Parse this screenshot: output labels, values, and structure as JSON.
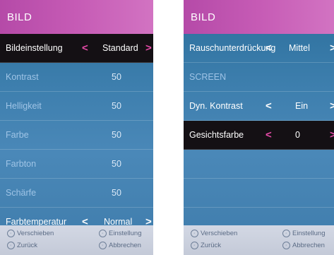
{
  "left": {
    "title": "BILD",
    "rows": [
      {
        "label": "Bildeinstellung",
        "value": "Standard"
      },
      {
        "label": "Kontrast",
        "value": "50"
      },
      {
        "label": "Helligkeit",
        "value": "50"
      },
      {
        "label": "Farbe",
        "value": "50"
      },
      {
        "label": "Farbton",
        "value": "50"
      },
      {
        "label": "Schärfe",
        "value": "50"
      },
      {
        "label": "Farbtemperatur",
        "value": "Normal"
      }
    ],
    "footer": {
      "move": "Verschieben",
      "back": "Zurück",
      "setting": "Einstellung",
      "cancel": "Abbrechen"
    }
  },
  "right": {
    "title": "BILD",
    "rows": [
      {
        "label": "Rauschunterdrückung",
        "value": "Mittel"
      },
      {
        "label": "SCREEN"
      },
      {
        "label": "Dyn. Kontrast",
        "value": "Ein"
      },
      {
        "label": "Gesichtsfarbe",
        "value": "0"
      }
    ],
    "footer": {
      "move": "Verschieben",
      "back": "Zurück",
      "setting": "Einstellung",
      "cancel": "Abbrechen"
    }
  },
  "glyphs": {
    "left_arrow": "<",
    "right_arrow": ">"
  },
  "colors": {
    "header": "#c65bb5",
    "panel": "#3e7fae",
    "selected_row": "#141014",
    "pink_arrow": "#e64aa8"
  }
}
